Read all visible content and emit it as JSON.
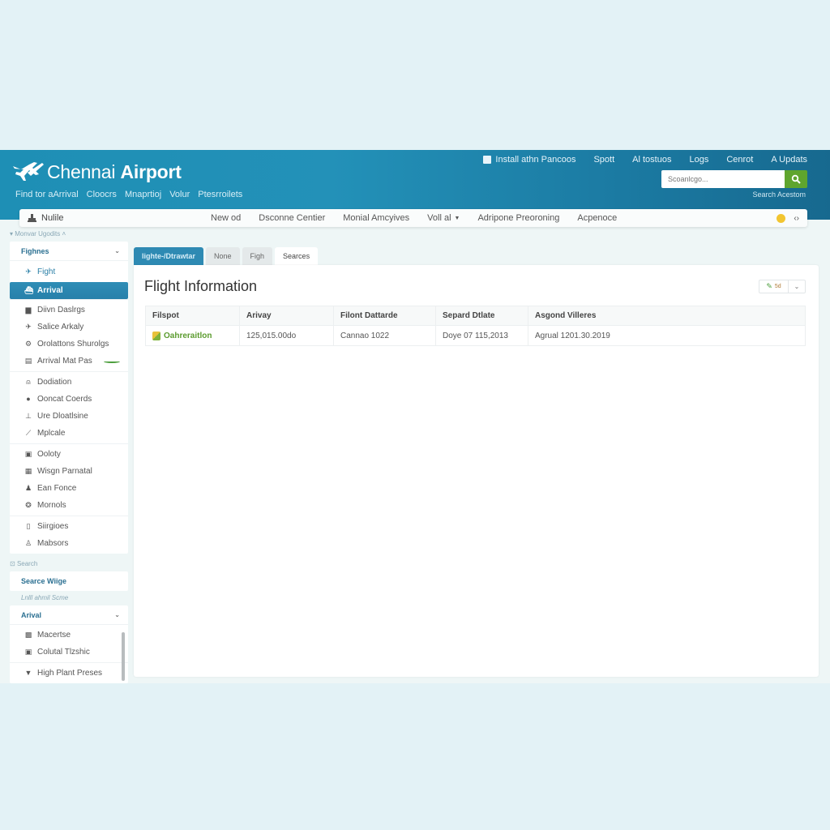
{
  "header": {
    "brand_light": "Chennai ",
    "brand_bold": "Airport",
    "subnav": [
      "Find tor aArrival",
      "Cloocrs",
      "Mnaprtioj",
      "Volur",
      "Ptesrroilets"
    ],
    "topnav": [
      "Install athn Pancoos",
      "Spott",
      "Al tostuos",
      "Logs",
      "Cenrot",
      "A Updats"
    ],
    "search_placeholder": "Scoanlcgo...",
    "search_link": "Search Acestom"
  },
  "navbar": {
    "home_label": "Nulile",
    "items": [
      "New od",
      "Dsconne Centier",
      "Monial Amcyives",
      "Voll al",
      "Adripone Preoroning",
      "Acpenoce"
    ]
  },
  "sidebar": {
    "section1_label": "Monvar Ugodits",
    "dropdown1": "Fighnes",
    "flight_item": "Fight",
    "active_item": "Arrival",
    "group1": [
      "Diivn Daslrgs",
      "Salice Arkaly",
      "Orolattons Shurolgs",
      "Arrival Mat Pas"
    ],
    "group2": [
      "Dodiation",
      "Ooncat Coerds",
      "Ure Dloatlsine",
      "Mplcale"
    ],
    "group3": [
      "Ooloty",
      "Wisgn Parnatal",
      "Ean Fonce",
      "Mornols"
    ],
    "group4": [
      "Siirgioes",
      "Mabsors"
    ],
    "section2_label": "Search",
    "search_widget": "Searce Wiige",
    "hint_text": "Lnlll ahmil Scme",
    "dropdown2": "Arival",
    "group5": [
      "Macertse",
      "Colutal Tlzshic"
    ],
    "group6": [
      "High Plant Preses"
    ]
  },
  "tabs": [
    "lighte-/Dtrawtar",
    "None",
    "Figh",
    "Searces"
  ],
  "main": {
    "title": "Flight Information",
    "tool_label": "5d",
    "table": {
      "columns": [
        "Filspot",
        "Arivay",
        "Filont Dattarde",
        "Separd Dtlate",
        "Asgond Villeres"
      ],
      "rows": [
        [
          "Oahreraitlon",
          "125,015.00do",
          "Cannao 1022",
          "Doye 07 115,2013",
          "Agrual 1201.30.2019"
        ]
      ]
    }
  },
  "colors": {
    "header": "#2391b8",
    "accent": "#2e8ab3",
    "search_button": "#5fa52e",
    "status_green": "#5b9b2e"
  }
}
